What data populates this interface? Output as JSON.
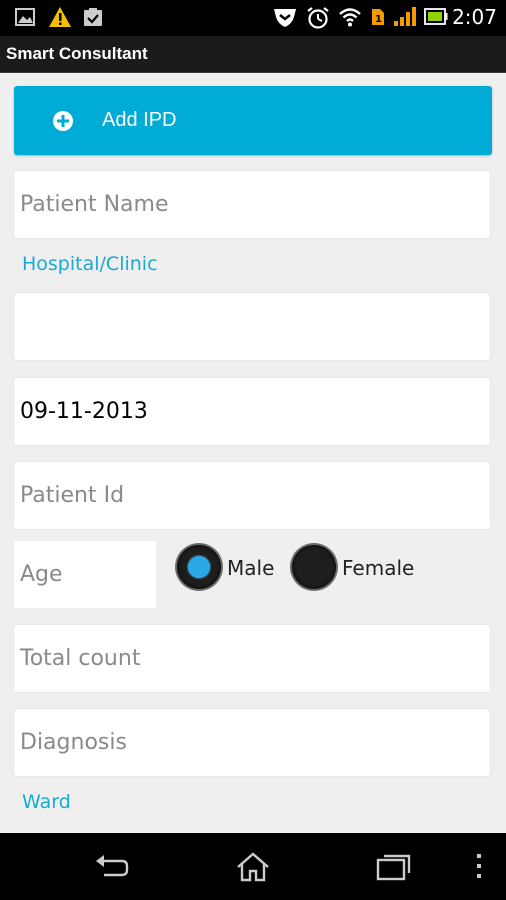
{
  "status_bar": {
    "time": "2:07",
    "icons": [
      "gallery-icon",
      "warning-icon",
      "clipboard-check-icon",
      "shield-icon",
      "alarm-clock-icon",
      "wifi-icon",
      "sim-icon",
      "signal-icon",
      "battery-icon"
    ]
  },
  "app": {
    "title": "Smart Consultant"
  },
  "form": {
    "add_button_label": "Add IPD",
    "patient_name_placeholder": "Patient Name",
    "hospital_label": "Hospital/Clinic",
    "hospital_value": "",
    "date_value": "09-11-2013",
    "patient_id_placeholder": "Patient Id",
    "age_placeholder": "Age",
    "gender": {
      "options": [
        "Male",
        "Female"
      ],
      "selected": "Male"
    },
    "total_count_placeholder": "Total count",
    "diagnosis_placeholder": "Diagnosis",
    "ward_label": "Ward"
  },
  "nav_bar": {
    "buttons": [
      "back-icon",
      "home-icon",
      "recent-apps-icon",
      "overflow-menu-icon"
    ]
  },
  "colors": {
    "accent": "#00acd6",
    "label": "#1aa9d6",
    "radio_selected": "#2aa7e6"
  }
}
